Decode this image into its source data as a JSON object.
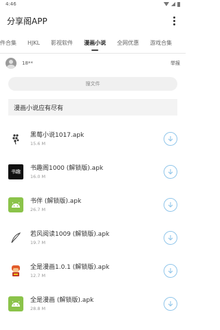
{
  "status": {
    "time": "4:46"
  },
  "app": {
    "title": "分享阁APP"
  },
  "tabs": [
    {
      "label": "软件合集",
      "active": false
    },
    {
      "label": "HJKL",
      "active": false
    },
    {
      "label": "影视软件",
      "active": false
    },
    {
      "label": "漫画小说",
      "active": true
    },
    {
      "label": "全网优惠",
      "active": false
    },
    {
      "label": "游戏合集",
      "active": false
    }
  ],
  "user": {
    "name": "18**",
    "report_label": "举报"
  },
  "search": {
    "label": "搜文件"
  },
  "banner": {
    "text": "漫画小说应有尽有"
  },
  "files": [
    {
      "name": "黑莓小说1017.apk",
      "size": "15.6 M",
      "icon": "blackberry-icon"
    },
    {
      "name": "书趣阁1000 (解锁版).apk",
      "size": "16.0 M",
      "icon": "shuquge-icon",
      "icon_text": "书趣"
    },
    {
      "name": "书伴 (解锁版).apk",
      "size": "26.7 M",
      "icon": "android-icon"
    },
    {
      "name": "若风阅读1009 (解锁版).apk",
      "size": "19.7 M",
      "icon": "feather-pen-icon"
    },
    {
      "name": "全是漫画1.0.1 (解锁版).apk",
      "size": "12.7 M",
      "icon": "comic-character-icon"
    },
    {
      "name": "全是漫画 (解锁版).apk",
      "size": "28.8 M",
      "icon": "android-icon"
    }
  ],
  "colors": {
    "download_ring": "#8fc5ea",
    "android_green": "#8bc34a"
  }
}
